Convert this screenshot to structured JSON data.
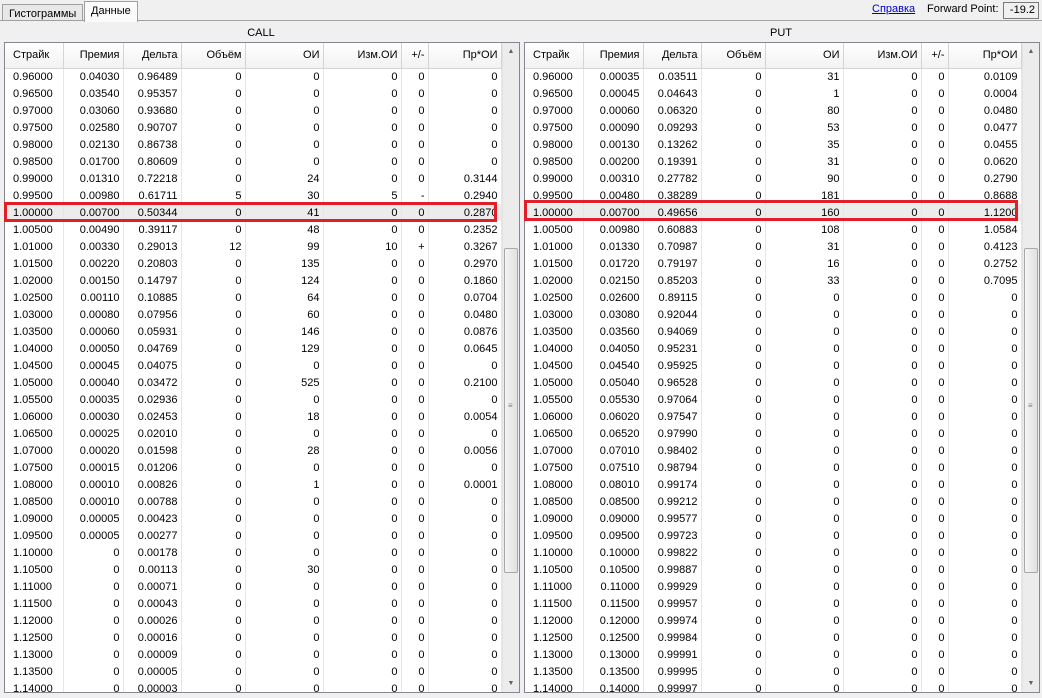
{
  "tabs": [
    {
      "label": "Гистограммы",
      "active": false
    },
    {
      "label": "Данные",
      "active": true
    }
  ],
  "help_link": "Справка",
  "forward_point": {
    "label": "Forward Point:",
    "value": "-19.2"
  },
  "colors": {
    "highlight": "#e21e26",
    "link": "#0000cc",
    "selected_row": "#ececec"
  },
  "call": {
    "title": "CALL",
    "columns": [
      "Страйк",
      "Премия",
      "Дельта",
      "Объём",
      "ОИ",
      "Изм.ОИ",
      "+/-",
      "Пр*ОИ"
    ],
    "highlighted_row": 8,
    "rows": [
      [
        "0.96000",
        "0.04030",
        "0.96489",
        "0",
        "0",
        "0",
        "0",
        "0"
      ],
      [
        "0.96500",
        "0.03540",
        "0.95357",
        "0",
        "0",
        "0",
        "0",
        "0"
      ],
      [
        "0.97000",
        "0.03060",
        "0.93680",
        "0",
        "0",
        "0",
        "0",
        "0"
      ],
      [
        "0.97500",
        "0.02580",
        "0.90707",
        "0",
        "0",
        "0",
        "0",
        "0"
      ],
      [
        "0.98000",
        "0.02130",
        "0.86738",
        "0",
        "0",
        "0",
        "0",
        "0"
      ],
      [
        "0.98500",
        "0.01700",
        "0.80609",
        "0",
        "0",
        "0",
        "0",
        "0"
      ],
      [
        "0.99000",
        "0.01310",
        "0.72218",
        "0",
        "24",
        "0",
        "0",
        "0.3144"
      ],
      [
        "0.99500",
        "0.00980",
        "0.61711",
        "5",
        "30",
        "5",
        "-",
        "0.2940"
      ],
      [
        "1.00000",
        "0.00700",
        "0.50344",
        "0",
        "41",
        "0",
        "0",
        "0.2870"
      ],
      [
        "1.00500",
        "0.00490",
        "0.39117",
        "0",
        "48",
        "0",
        "0",
        "0.2352"
      ],
      [
        "1.01000",
        "0.00330",
        "0.29013",
        "12",
        "99",
        "10",
        "+",
        "0.3267"
      ],
      [
        "1.01500",
        "0.00220",
        "0.20803",
        "0",
        "135",
        "0",
        "0",
        "0.2970"
      ],
      [
        "1.02000",
        "0.00150",
        "0.14797",
        "0",
        "124",
        "0",
        "0",
        "0.1860"
      ],
      [
        "1.02500",
        "0.00110",
        "0.10885",
        "0",
        "64",
        "0",
        "0",
        "0.0704"
      ],
      [
        "1.03000",
        "0.00080",
        "0.07956",
        "0",
        "60",
        "0",
        "0",
        "0.0480"
      ],
      [
        "1.03500",
        "0.00060",
        "0.05931",
        "0",
        "146",
        "0",
        "0",
        "0.0876"
      ],
      [
        "1.04000",
        "0.00050",
        "0.04769",
        "0",
        "129",
        "0",
        "0",
        "0.0645"
      ],
      [
        "1.04500",
        "0.00045",
        "0.04075",
        "0",
        "0",
        "0",
        "0",
        "0"
      ],
      [
        "1.05000",
        "0.00040",
        "0.03472",
        "0",
        "525",
        "0",
        "0",
        "0.2100"
      ],
      [
        "1.05500",
        "0.00035",
        "0.02936",
        "0",
        "0",
        "0",
        "0",
        "0"
      ],
      [
        "1.06000",
        "0.00030",
        "0.02453",
        "0",
        "18",
        "0",
        "0",
        "0.0054"
      ],
      [
        "1.06500",
        "0.00025",
        "0.02010",
        "0",
        "0",
        "0",
        "0",
        "0"
      ],
      [
        "1.07000",
        "0.00020",
        "0.01598",
        "0",
        "28",
        "0",
        "0",
        "0.0056"
      ],
      [
        "1.07500",
        "0.00015",
        "0.01206",
        "0",
        "0",
        "0",
        "0",
        "0"
      ],
      [
        "1.08000",
        "0.00010",
        "0.00826",
        "0",
        "1",
        "0",
        "0",
        "0.0001"
      ],
      [
        "1.08500",
        "0.00010",
        "0.00788",
        "0",
        "0",
        "0",
        "0",
        "0"
      ],
      [
        "1.09000",
        "0.00005",
        "0.00423",
        "0",
        "0",
        "0",
        "0",
        "0"
      ],
      [
        "1.09500",
        "0.00005",
        "0.00277",
        "0",
        "0",
        "0",
        "0",
        "0"
      ],
      [
        "1.10000",
        "0",
        "0.00178",
        "0",
        "0",
        "0",
        "0",
        "0"
      ],
      [
        "1.10500",
        "0",
        "0.00113",
        "0",
        "30",
        "0",
        "0",
        "0"
      ],
      [
        "1.11000",
        "0",
        "0.00071",
        "0",
        "0",
        "0",
        "0",
        "0"
      ],
      [
        "1.11500",
        "0",
        "0.00043",
        "0",
        "0",
        "0",
        "0",
        "0"
      ],
      [
        "1.12000",
        "0",
        "0.00026",
        "0",
        "0",
        "0",
        "0",
        "0"
      ],
      [
        "1.12500",
        "0",
        "0.00016",
        "0",
        "0",
        "0",
        "0",
        "0"
      ],
      [
        "1.13000",
        "0",
        "0.00009",
        "0",
        "0",
        "0",
        "0",
        "0"
      ],
      [
        "1.13500",
        "0",
        "0.00005",
        "0",
        "0",
        "0",
        "0",
        "0"
      ],
      [
        "1.14000",
        "0",
        "0.00003",
        "0",
        "0",
        "0",
        "0",
        "0"
      ]
    ]
  },
  "put": {
    "title": "PUT",
    "columns": [
      "Страйк",
      "Премия",
      "Дельта",
      "Объём",
      "ОИ",
      "Изм.ОИ",
      "+/-",
      "Пр*ОИ"
    ],
    "highlighted_row": 8,
    "rows": [
      [
        "0.96000",
        "0.00035",
        "0.03511",
        "0",
        "31",
        "0",
        "0",
        "0.0109"
      ],
      [
        "0.96500",
        "0.00045",
        "0.04643",
        "0",
        "1",
        "0",
        "0",
        "0.0004"
      ],
      [
        "0.97000",
        "0.00060",
        "0.06320",
        "0",
        "80",
        "0",
        "0",
        "0.0480"
      ],
      [
        "0.97500",
        "0.00090",
        "0.09293",
        "0",
        "53",
        "0",
        "0",
        "0.0477"
      ],
      [
        "0.98000",
        "0.00130",
        "0.13262",
        "0",
        "35",
        "0",
        "0",
        "0.0455"
      ],
      [
        "0.98500",
        "0.00200",
        "0.19391",
        "0",
        "31",
        "0",
        "0",
        "0.0620"
      ],
      [
        "0.99000",
        "0.00310",
        "0.27782",
        "0",
        "90",
        "0",
        "0",
        "0.2790"
      ],
      [
        "0.99500",
        "0.00480",
        "0.38289",
        "0",
        "181",
        "0",
        "0",
        "0.8688"
      ],
      [
        "1.00000",
        "0.00700",
        "0.49656",
        "0",
        "160",
        "0",
        "0",
        "1.1200"
      ],
      [
        "1.00500",
        "0.00980",
        "0.60883",
        "0",
        "108",
        "0",
        "0",
        "1.0584"
      ],
      [
        "1.01000",
        "0.01330",
        "0.70987",
        "0",
        "31",
        "0",
        "0",
        "0.4123"
      ],
      [
        "1.01500",
        "0.01720",
        "0.79197",
        "0",
        "16",
        "0",
        "0",
        "0.2752"
      ],
      [
        "1.02000",
        "0.02150",
        "0.85203",
        "0",
        "33",
        "0",
        "0",
        "0.7095"
      ],
      [
        "1.02500",
        "0.02600",
        "0.89115",
        "0",
        "0",
        "0",
        "0",
        "0"
      ],
      [
        "1.03000",
        "0.03080",
        "0.92044",
        "0",
        "0",
        "0",
        "0",
        "0"
      ],
      [
        "1.03500",
        "0.03560",
        "0.94069",
        "0",
        "0",
        "0",
        "0",
        "0"
      ],
      [
        "1.04000",
        "0.04050",
        "0.95231",
        "0",
        "0",
        "0",
        "0",
        "0"
      ],
      [
        "1.04500",
        "0.04540",
        "0.95925",
        "0",
        "0",
        "0",
        "0",
        "0"
      ],
      [
        "1.05000",
        "0.05040",
        "0.96528",
        "0",
        "0",
        "0",
        "0",
        "0"
      ],
      [
        "1.05500",
        "0.05530",
        "0.97064",
        "0",
        "0",
        "0",
        "0",
        "0"
      ],
      [
        "1.06000",
        "0.06020",
        "0.97547",
        "0",
        "0",
        "0",
        "0",
        "0"
      ],
      [
        "1.06500",
        "0.06520",
        "0.97990",
        "0",
        "0",
        "0",
        "0",
        "0"
      ],
      [
        "1.07000",
        "0.07010",
        "0.98402",
        "0",
        "0",
        "0",
        "0",
        "0"
      ],
      [
        "1.07500",
        "0.07510",
        "0.98794",
        "0",
        "0",
        "0",
        "0",
        "0"
      ],
      [
        "1.08000",
        "0.08010",
        "0.99174",
        "0",
        "0",
        "0",
        "0",
        "0"
      ],
      [
        "1.08500",
        "0.08500",
        "0.99212",
        "0",
        "0",
        "0",
        "0",
        "0"
      ],
      [
        "1.09000",
        "0.09000",
        "0.99577",
        "0",
        "0",
        "0",
        "0",
        "0"
      ],
      [
        "1.09500",
        "0.09500",
        "0.99723",
        "0",
        "0",
        "0",
        "0",
        "0"
      ],
      [
        "1.10000",
        "0.10000",
        "0.99822",
        "0",
        "0",
        "0",
        "0",
        "0"
      ],
      [
        "1.10500",
        "0.10500",
        "0.99887",
        "0",
        "0",
        "0",
        "0",
        "0"
      ],
      [
        "1.11000",
        "0.11000",
        "0.99929",
        "0",
        "0",
        "0",
        "0",
        "0"
      ],
      [
        "1.11500",
        "0.11500",
        "0.99957",
        "0",
        "0",
        "0",
        "0",
        "0"
      ],
      [
        "1.12000",
        "0.12000",
        "0.99974",
        "0",
        "0",
        "0",
        "0",
        "0"
      ],
      [
        "1.12500",
        "0.12500",
        "0.99984",
        "0",
        "0",
        "0",
        "0",
        "0"
      ],
      [
        "1.13000",
        "0.13000",
        "0.99991",
        "0",
        "0",
        "0",
        "0",
        "0"
      ],
      [
        "1.13500",
        "0.13500",
        "0.99995",
        "0",
        "0",
        "0",
        "0",
        "0"
      ],
      [
        "1.14000",
        "0.14000",
        "0.99997",
        "0",
        "0",
        "0",
        "0",
        "0"
      ]
    ]
  }
}
